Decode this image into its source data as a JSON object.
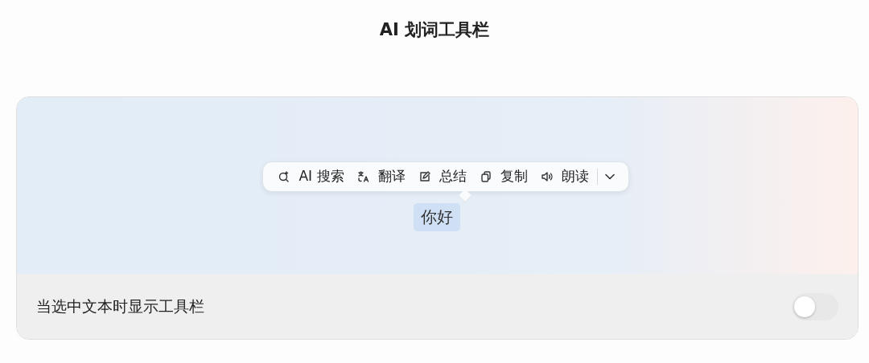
{
  "title": "AI 划词工具栏",
  "toolbar": {
    "items": [
      {
        "kind": "ai-search",
        "label": "AI 搜索"
      },
      {
        "kind": "translate",
        "label": "翻译"
      },
      {
        "kind": "summary",
        "label": "总结"
      },
      {
        "kind": "copy",
        "label": "复制"
      },
      {
        "kind": "read-aloud",
        "label": "朗读"
      }
    ],
    "more_menu": {
      "expanded": false
    }
  },
  "selected_text": "你好",
  "setting": {
    "label": "当选中文本时显示工具栏",
    "on": false
  }
}
